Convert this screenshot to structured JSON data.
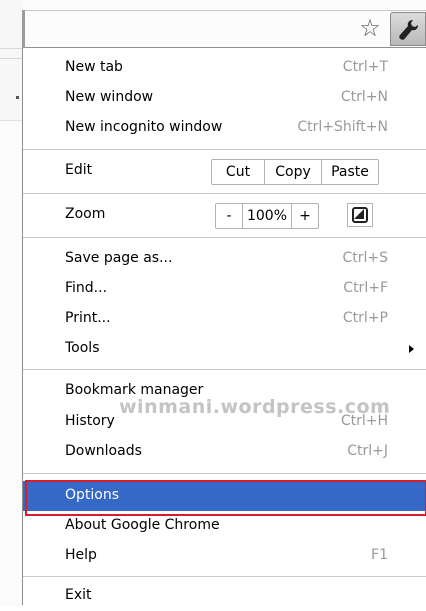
{
  "toolbar": {
    "star_icon": "star-icon",
    "wrench_icon": "wrench-icon"
  },
  "menu": {
    "new_tab": {
      "label": "New tab",
      "shortcut": "Ctrl+T"
    },
    "new_window": {
      "label": "New window",
      "shortcut": "Ctrl+N"
    },
    "new_incognito": {
      "label": "New incognito window",
      "shortcut": "Ctrl+Shift+N"
    },
    "edit": {
      "label": "Edit",
      "cut": "Cut",
      "copy": "Copy",
      "paste": "Paste"
    },
    "zoom": {
      "label": "Zoom",
      "minus": "-",
      "level": "100%",
      "plus": "+"
    },
    "save_page": {
      "label": "Save page as...",
      "shortcut": "Ctrl+S"
    },
    "find": {
      "label": "Find...",
      "shortcut": "Ctrl+F"
    },
    "print": {
      "label": "Print...",
      "shortcut": "Ctrl+P"
    },
    "tools": {
      "label": "Tools"
    },
    "bookmark_manager": {
      "label": "Bookmark manager"
    },
    "history": {
      "label": "History",
      "shortcut": "Ctrl+H"
    },
    "downloads": {
      "label": "Downloads",
      "shortcut": "Ctrl+J"
    },
    "options": {
      "label": "Options"
    },
    "about": {
      "label": "About Google Chrome"
    },
    "help": {
      "label": "Help",
      "shortcut": "F1"
    },
    "exit": {
      "label": "Exit"
    }
  },
  "watermark": "winmani.wordpress.com",
  "colors": {
    "highlight": "#3568c7",
    "outline": "#d21f2b"
  }
}
